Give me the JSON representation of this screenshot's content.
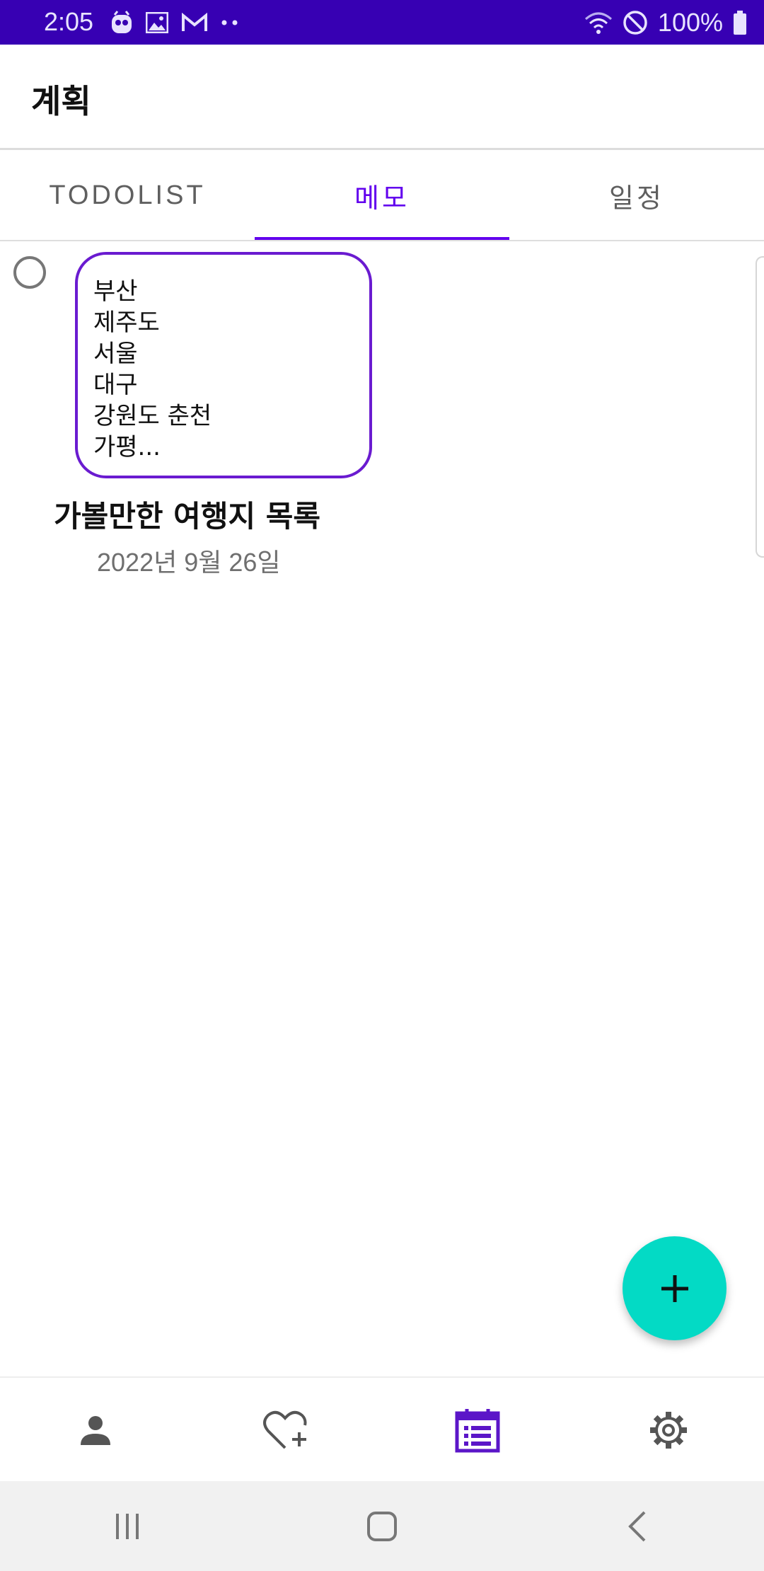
{
  "status_bar": {
    "time": "2:05",
    "battery_percent": "100%",
    "left_icons": [
      "app-notification-icon",
      "image-icon",
      "gmail-icon",
      "more-dots-icon"
    ],
    "right_icons": [
      "wifi-icon",
      "do-not-disturb-icon",
      "battery-icon"
    ],
    "background_color": "#3700b3"
  },
  "app_bar": {
    "title": "계획"
  },
  "tabs": [
    {
      "label": "TODOLIST",
      "active": false
    },
    {
      "label": "메모",
      "active": true
    },
    {
      "label": "일정",
      "active": false
    }
  ],
  "memo": {
    "preview_lines": [
      "부산",
      "제주도",
      "서울",
      "대구",
      "강원도 춘천",
      "가평..."
    ],
    "title": "가볼만한 여행지 목록",
    "date": "2022년 9월 26일",
    "border_color": "#6a1bd0"
  },
  "fab": {
    "icon": "plus-icon",
    "color": "#03dac5"
  },
  "bottom_nav": [
    {
      "icon": "person-icon",
      "active": false
    },
    {
      "icon": "heart-plus-icon",
      "active": false
    },
    {
      "icon": "calendar-list-icon",
      "active": true
    },
    {
      "icon": "gear-icon",
      "active": false
    }
  ],
  "system_nav": [
    "recent-apps-icon",
    "home-icon",
    "back-icon"
  ],
  "accent_color": "#6200ee"
}
